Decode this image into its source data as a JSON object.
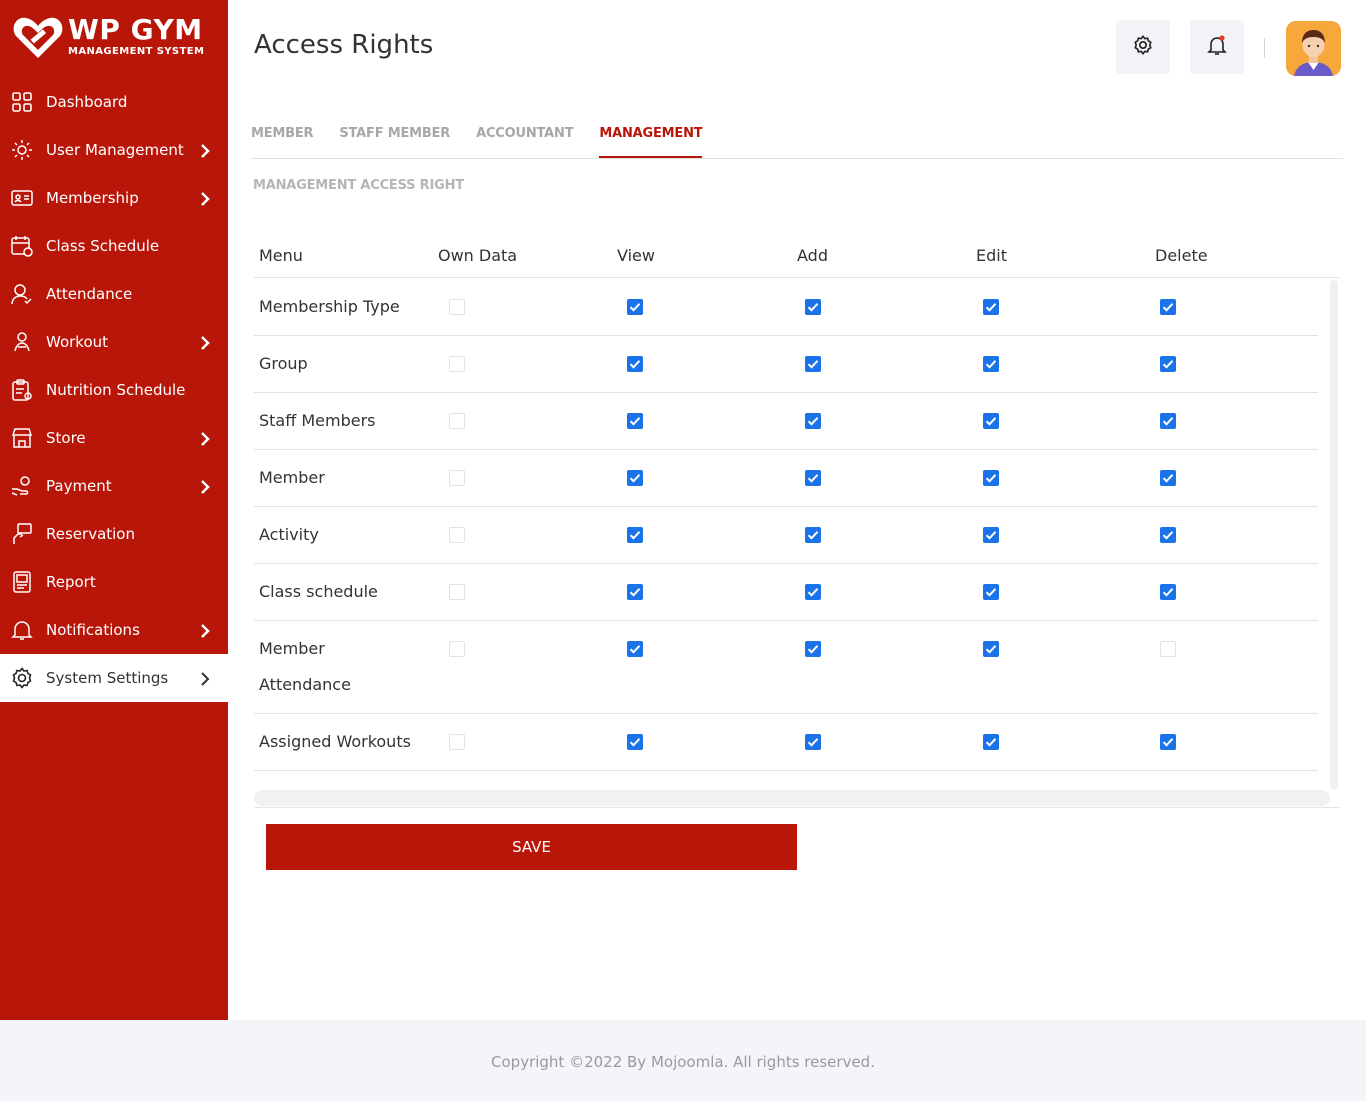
{
  "brand": {
    "title": "WP GYM",
    "subtitle": "MANAGEMENT SYSTEM",
    "color": "#b9160a"
  },
  "sidebar": {
    "items": [
      {
        "label": "Dashboard",
        "icon": "dashboard-icon",
        "has_submenu": false
      },
      {
        "label": "User Management",
        "icon": "users-gear-icon",
        "has_submenu": true
      },
      {
        "label": "Membership",
        "icon": "membership-card-icon",
        "has_submenu": true
      },
      {
        "label": "Class Schedule",
        "icon": "calendar-icon",
        "has_submenu": false
      },
      {
        "label": "Attendance",
        "icon": "user-check-icon",
        "has_submenu": false
      },
      {
        "label": "Workout",
        "icon": "workout-icon",
        "has_submenu": true
      },
      {
        "label": "Nutrition Schedule",
        "icon": "nutrition-clipboard-icon",
        "has_submenu": false
      },
      {
        "label": "Store",
        "icon": "store-icon",
        "has_submenu": true
      },
      {
        "label": "Payment",
        "icon": "payment-hand-icon",
        "has_submenu": true
      },
      {
        "label": "Reservation",
        "icon": "reservation-icon",
        "has_submenu": false
      },
      {
        "label": "Report",
        "icon": "report-icon",
        "has_submenu": false
      },
      {
        "label": "Notifications",
        "icon": "bell-icon",
        "has_submenu": true
      },
      {
        "label": "System Settings",
        "icon": "gear-icon",
        "has_submenu": true,
        "active": true
      }
    ]
  },
  "header": {
    "title": "Access Rights",
    "settings_icon": "gear-icon",
    "notification_icon": "bell-icon",
    "avatar_icon": "user-avatar-icon"
  },
  "tabs": [
    {
      "label": "MEMBER",
      "active": false
    },
    {
      "label": "STAFF MEMBER",
      "active": false
    },
    {
      "label": "ACCOUNTANT",
      "active": false
    },
    {
      "label": "MANAGEMENT",
      "active": true
    }
  ],
  "section_title": "MANAGEMENT ACCESS RIGHT",
  "table": {
    "columns": [
      "Menu",
      "Own Data",
      "View",
      "Add",
      "Edit",
      "Delete"
    ],
    "rows": [
      {
        "menu": "Membership Type",
        "own_data": false,
        "view": true,
        "add": true,
        "edit": true,
        "delete": true
      },
      {
        "menu": "Group",
        "own_data": false,
        "view": true,
        "add": true,
        "edit": true,
        "delete": true
      },
      {
        "menu": "Staff Members",
        "own_data": false,
        "view": true,
        "add": true,
        "edit": true,
        "delete": true
      },
      {
        "menu": "Member",
        "own_data": false,
        "view": true,
        "add": true,
        "edit": true,
        "delete": true
      },
      {
        "menu": "Activity",
        "own_data": false,
        "view": true,
        "add": true,
        "edit": true,
        "delete": true
      },
      {
        "menu": "Class schedule",
        "own_data": false,
        "view": true,
        "add": true,
        "edit": true,
        "delete": true
      },
      {
        "menu_line1": "Member",
        "menu_line2": "Attendance",
        "own_data": false,
        "view": true,
        "add": true,
        "edit": true,
        "delete": false
      },
      {
        "menu": "Assigned Workouts",
        "own_data": false,
        "view": true,
        "add": true,
        "edit": true,
        "delete": true
      },
      {
        "menu": "",
        "own_data": false,
        "view": true,
        "add": true,
        "edit": false,
        "delete": true
      }
    ]
  },
  "save_button": {
    "label": "SAVE"
  },
  "footer": {
    "text": "Copyright ©2022 By Mojoomla. All rights reserved."
  },
  "colors": {
    "checkbox_on": "#1a73e8",
    "accent": "#b9160a"
  }
}
